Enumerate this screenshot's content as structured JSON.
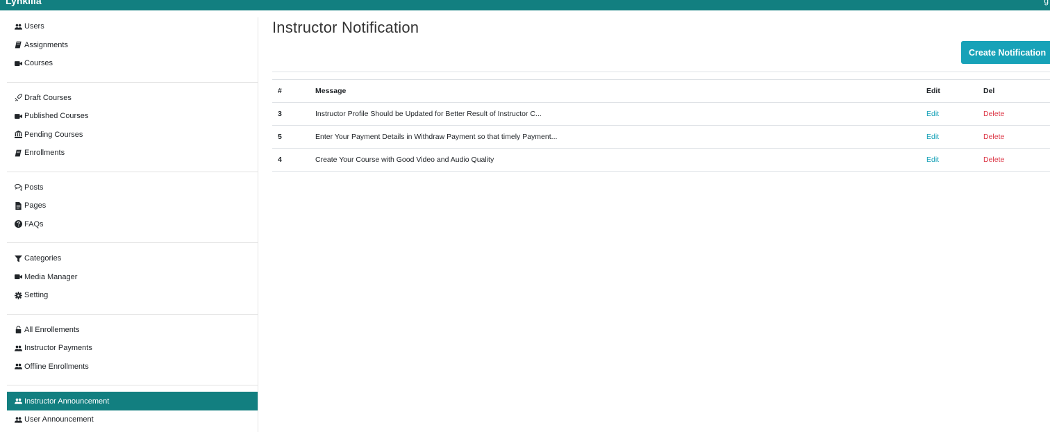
{
  "app": {
    "brand": "Lynkilla",
    "top_right_glyph": "g"
  },
  "sidebar": {
    "groups": [
      {
        "items": [
          {
            "label": "Users",
            "icon": "users-icon"
          },
          {
            "label": "Assignments",
            "icon": "book-icon"
          },
          {
            "label": "Courses",
            "icon": "video-icon"
          }
        ]
      },
      {
        "items": [
          {
            "label": "Draft Courses",
            "icon": "rocket-icon"
          },
          {
            "label": "Published Courses",
            "icon": "video-icon"
          },
          {
            "label": "Pending Courses",
            "icon": "bank-icon"
          },
          {
            "label": "Enrollments",
            "icon": "book-icon"
          }
        ]
      },
      {
        "items": [
          {
            "label": "Posts",
            "icon": "comments-icon"
          },
          {
            "label": "Pages",
            "icon": "file-icon"
          },
          {
            "label": "FAQs",
            "icon": "question-icon"
          }
        ]
      },
      {
        "items": [
          {
            "label": "Categories",
            "icon": "filter-icon"
          },
          {
            "label": "Media Manager",
            "icon": "video-icon"
          },
          {
            "label": "Setting",
            "icon": "gear-icon"
          }
        ]
      },
      {
        "items": [
          {
            "label": "All Enrollements",
            "icon": "lock-icon"
          },
          {
            "label": "Instructor Payments",
            "icon": "users-icon"
          },
          {
            "label": "Offline Enrollments",
            "icon": "users-icon"
          }
        ]
      },
      {
        "items": [
          {
            "label": "Instructor Announcement",
            "icon": "users-icon",
            "active": true
          },
          {
            "label": "User Announcement",
            "icon": "users-icon"
          }
        ]
      }
    ]
  },
  "main": {
    "title": "Instructor Notification",
    "create_button": "Create Notification",
    "table": {
      "headers": {
        "num": "#",
        "message": "Message",
        "edit": "Edit",
        "del": "Del"
      },
      "rows": [
        {
          "num": "3",
          "message": "Instructor Profile Should be Updated for Better Result of Instructor C...",
          "edit": "Edit",
          "del": "Delete"
        },
        {
          "num": "5",
          "message": "Enter Your Payment Details in Withdraw Payment so that timely Payment...",
          "edit": "Edit",
          "del": "Delete"
        },
        {
          "num": "4",
          "message": "Create Your Course with Good Video and Audio Quality",
          "edit": "Edit",
          "del": "Delete"
        }
      ]
    }
  },
  "colors": {
    "brand": "#127f80",
    "button": "#17a2b8",
    "edit_link": "#17a2b8",
    "delete_link": "#dc3545"
  }
}
